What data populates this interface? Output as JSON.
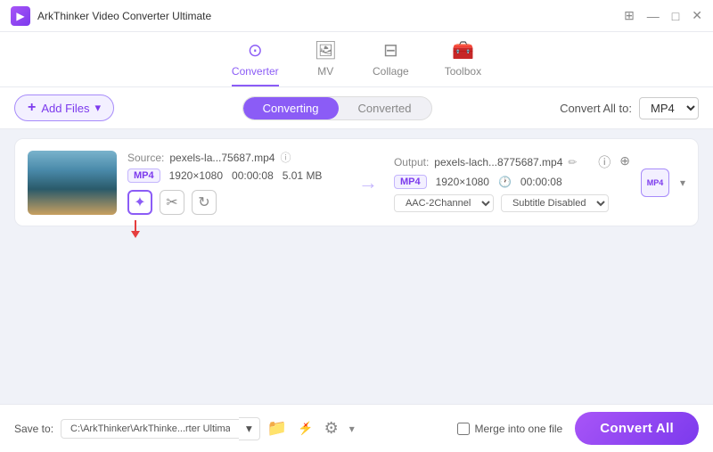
{
  "app": {
    "title": "ArkThinker Video Converter Ultimate",
    "icon": "▶"
  },
  "titlebar": {
    "controls": [
      "⊞",
      "—",
      "□",
      "✕"
    ]
  },
  "nav": {
    "items": [
      {
        "id": "converter",
        "label": "Converter",
        "icon": "⊙",
        "active": true
      },
      {
        "id": "mv",
        "label": "MV",
        "icon": "🖼"
      },
      {
        "id": "collage",
        "label": "Collage",
        "icon": "⊟"
      },
      {
        "id": "toolbox",
        "label": "Toolbox",
        "icon": "🧰"
      }
    ]
  },
  "toolbar": {
    "add_files_label": "Add Files",
    "tabs": [
      {
        "id": "converting",
        "label": "Converting",
        "active": true
      },
      {
        "id": "converted",
        "label": "Converted",
        "active": false
      }
    ],
    "convert_all_label": "Convert All to:",
    "format": "MP4"
  },
  "file_item": {
    "source_label": "Source:",
    "source_file": "pexels-la...75687.mp4",
    "info_icon": "ⓘ",
    "format": "MP4",
    "resolution": "1920×1080",
    "duration": "00:00:08",
    "size": "5.01 MB",
    "output_label": "Output:",
    "output_file": "pexels-lach...8775687.mp4",
    "edit_icon": "✏",
    "output_format": "MP4",
    "output_resolution": "1920×1080",
    "output_duration": "00:00:08",
    "audio_channel": "AAC-2Channel",
    "subtitle": "Subtitle Disabled",
    "mp4_badge": "MP4"
  },
  "bottom_bar": {
    "save_to_label": "Save to:",
    "save_path": "C:\\ArkThinker\\ArkThinke...rter Ultimate\\Converted",
    "merge_label": "Merge into one file",
    "convert_btn_label": "Convert All"
  }
}
